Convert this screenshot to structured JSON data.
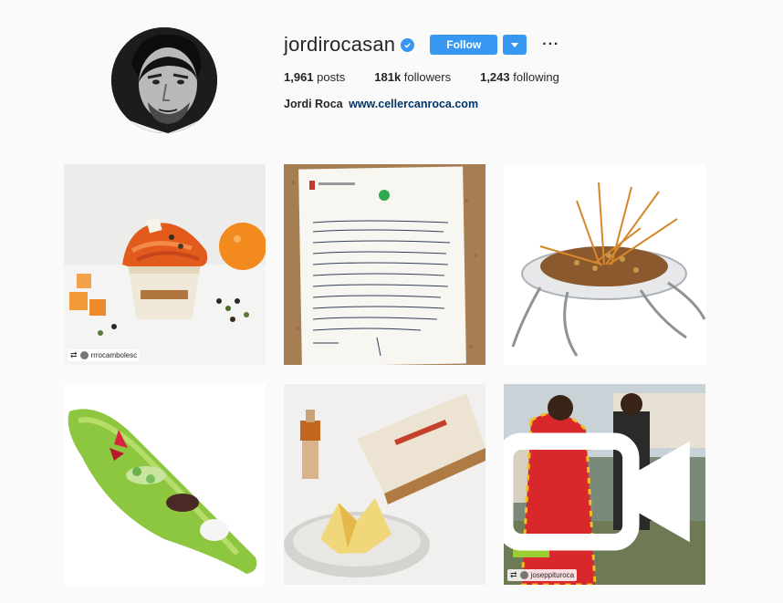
{
  "profile": {
    "username": "jordirocasan",
    "verified": true,
    "follow_label": "Follow",
    "more_label": "···",
    "stats": [
      {
        "count": "1,961",
        "label": "posts"
      },
      {
        "count": "181k",
        "label": "followers"
      },
      {
        "count": "1,243",
        "label": "following"
      }
    ],
    "bio_name": "Jordi Roca",
    "bio_link": "www.cellercanroca.com"
  },
  "posts": [
    {
      "subject": "ice cream cup with orange",
      "repost_user": "rrrocambolesc",
      "video": false
    },
    {
      "subject": "handwritten letter on corkboard",
      "repost_user": "",
      "video": false
    },
    {
      "subject": "plated dish with sticks",
      "repost_user": "",
      "video": false
    },
    {
      "subject": "green spoon dish",
      "repost_user": "",
      "video": false
    },
    {
      "subject": "book and paper dessert",
      "repost_user": "",
      "video": false
    },
    {
      "subject": "people outdoors",
      "repost_user": "joseppituroca",
      "video": true
    }
  ],
  "colors": {
    "accent": "#3897f0",
    "link": "#003569",
    "background": "#fafafa"
  }
}
